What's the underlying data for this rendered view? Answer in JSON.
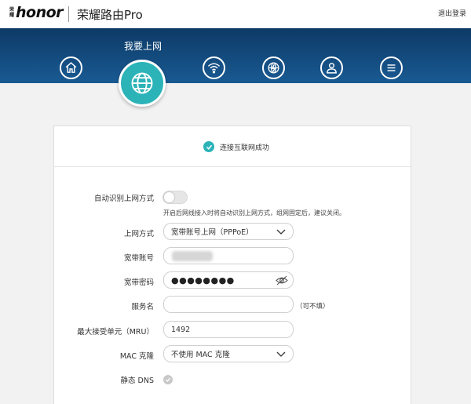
{
  "header": {
    "brand_small": "荣耀",
    "brand_logo": "honor",
    "product_name": "荣耀路由Pro",
    "logout": "退出登录"
  },
  "nav": {
    "active_title": "我要上网",
    "items": [
      {
        "icon": "home-icon"
      },
      {
        "icon": "globe-icon",
        "active": true
      },
      {
        "icon": "wifi-icon"
      },
      {
        "icon": "smart-accelerate-icon"
      },
      {
        "icon": "user-icon"
      },
      {
        "icon": "menu-icon"
      }
    ]
  },
  "status": {
    "text": "连接互联网成功",
    "color": "#2bb3b8"
  },
  "form": {
    "auto_detect_label": "自动识别上网方式",
    "auto_detect_on": false,
    "auto_detect_hint": "开启后网线接入时将自动识别上网方式，组网固定后，建议关闭。",
    "mode_label": "上网方式",
    "mode_value": "宽带账号上网（PPPoE）",
    "account_label": "宽带账号",
    "account_value": "",
    "password_label": "宽带密码",
    "password_value": "●●●●●●●●",
    "service_label": "服务名",
    "service_value": "",
    "service_optional": "（可不填）",
    "mru_label": "最大接受单元（MRU）",
    "mru_value": "1492",
    "mac_label": "MAC 克隆",
    "mac_value": "不使用 MAC 克隆",
    "dns_label": "静态 DNS",
    "dns_checked": false
  },
  "colors": {
    "accent": "#2bb3b8",
    "nav_bg": "#195a93"
  }
}
